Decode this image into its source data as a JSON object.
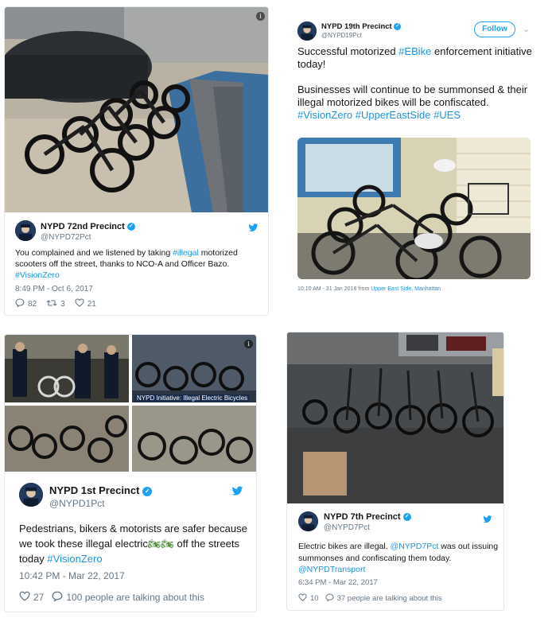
{
  "tweets": {
    "t72": {
      "name": "NYPD 72nd Precinct",
      "handle": "@NYPD72Pct",
      "text_a": "You complained and we listened by taking ",
      "tag1": "#illegal",
      "text_b": " motorized scooters off the street, thanks to NCO-A and Officer Bazo. ",
      "tag2": "#VisionZero",
      "time": "8:49 PM - Oct 6, 2017",
      "replies": "82",
      "retweets": "3",
      "likes": "21"
    },
    "t19": {
      "name": "NYPD 19th Precinct",
      "handle": "@NYPD19Pct",
      "follow_label": "Follow",
      "line1a": "Successful motorized ",
      "tag_ebike": "#EBike",
      "line1b": " enforcement initiative today!",
      "line2": "Businesses will continue to be summonsed & their illegal motorized bikes will be confiscated. ",
      "tag_vz": "#VisionZero",
      "tag_ues": "#UpperEastSide",
      "tag_ues2": "#UES",
      "time": "10:10 AM - 31 Jan 2018 from ",
      "location": "Upper East Side, Manhattan"
    },
    "t1": {
      "name": "NYPD 1st Precinct",
      "handle": "@NYPD1Pct",
      "text_a": "Pedestrians, bikers & motorists are safer because we took these illegal electric",
      "emoji": "🏍🏍",
      "text_b": " off the streets today ",
      "tag": "#VisionZero",
      "time": "10:42 PM - Mar 22, 2017",
      "likes": "27",
      "talking": "100 people are talking about this",
      "overlay": "NYPD Initiative: Illegal Electric Bicycles"
    },
    "t7": {
      "name": "NYPD 7th Precinct",
      "handle": "@NYPD7Pct",
      "text_a": "Electric bikes are illegal. ",
      "mention1": "@NYPD7Pct",
      "text_b": " was out issuing summonses and confiscating them today. ",
      "mention2": "@NYPDTransport",
      "time": "6:34 PM - Mar 22, 2017",
      "likes": "10",
      "talking": "37 people are talking about this"
    }
  },
  "colors": {
    "link": "#1b95e0",
    "verified": "#1da1f2",
    "muted": "#657786"
  },
  "icons": [
    "verified-icon",
    "twitter-bird-icon",
    "reply-icon",
    "retweet-icon",
    "heart-icon",
    "comment-icon",
    "chevron-down-icon",
    "info-icon"
  ]
}
